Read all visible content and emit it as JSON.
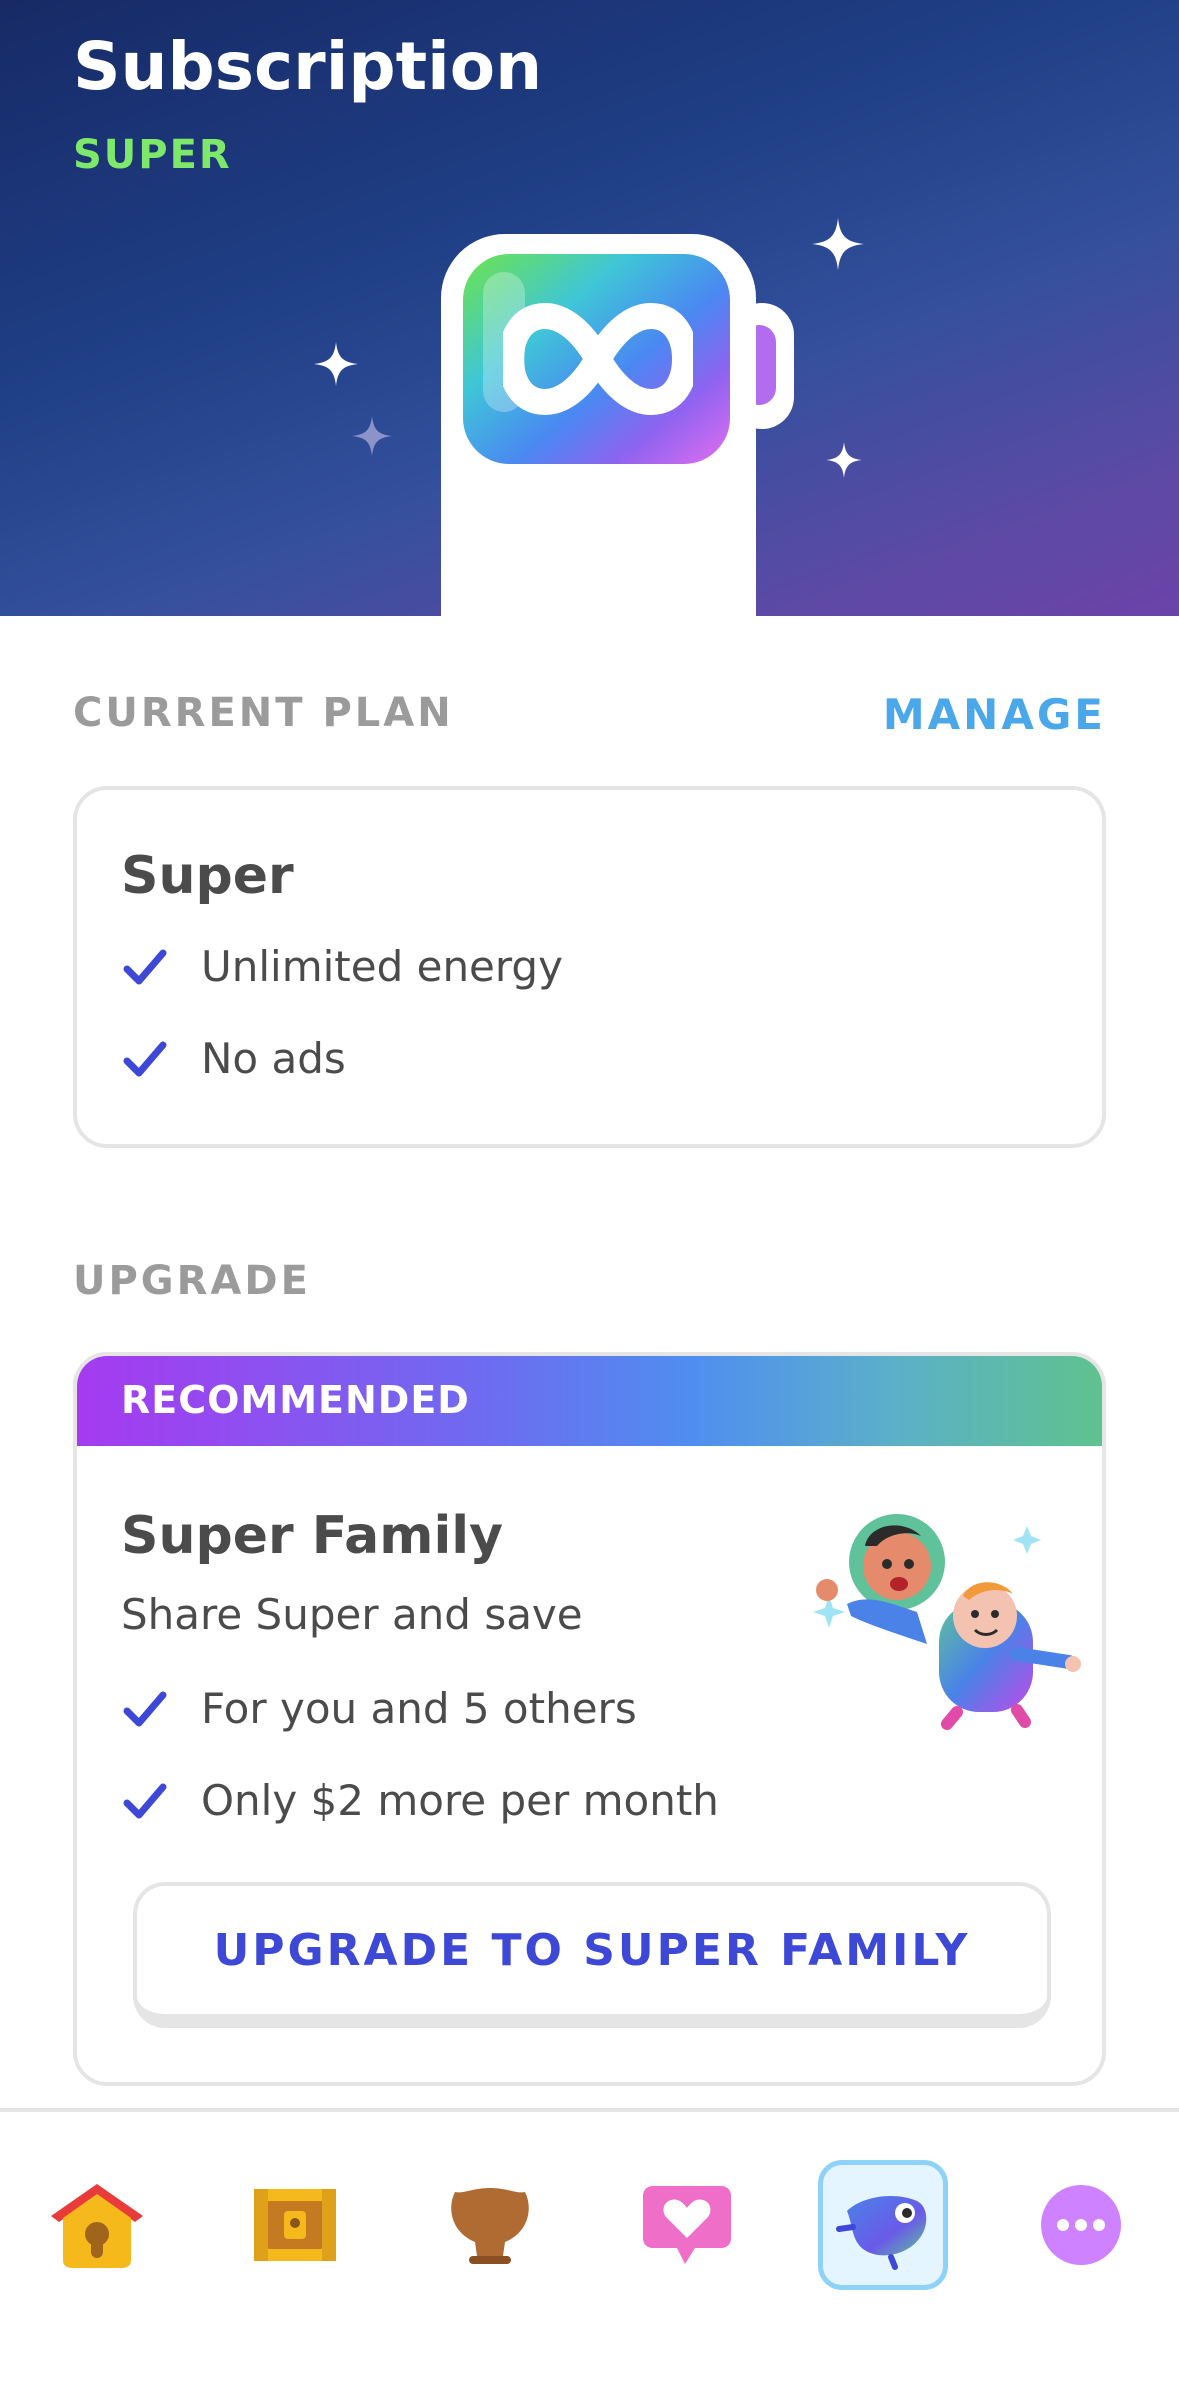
{
  "header": {
    "title": "Subscription",
    "tier": "SUPER",
    "tier_color": "#7ee86a"
  },
  "current_plan": {
    "section_label": "CURRENT PLAN",
    "manage_label": "MANAGE",
    "plan_name": "Super",
    "features": [
      "Unlimited energy",
      "No ads"
    ]
  },
  "upgrade": {
    "section_label": "UPGRADE",
    "badge": "RECOMMENDED",
    "plan_name": "Super Family",
    "subtitle": "Share Super and save",
    "features": [
      "For you and 5 others",
      "Only $2 more per month"
    ],
    "button_label": "UPGRADE TO SUPER FAMILY"
  },
  "bottom_nav": {
    "items": [
      {
        "icon": "home-icon",
        "active": false
      },
      {
        "icon": "chest-icon",
        "active": false
      },
      {
        "icon": "shield-league-icon",
        "active": false
      },
      {
        "icon": "heart-chat-icon",
        "active": false
      },
      {
        "icon": "super-duo-icon",
        "active": true
      },
      {
        "icon": "more-icon",
        "active": false
      }
    ]
  },
  "colors": {
    "accent_blue": "#49a7ea",
    "button_text": "#3d48d6",
    "check": "#3d48d6"
  }
}
